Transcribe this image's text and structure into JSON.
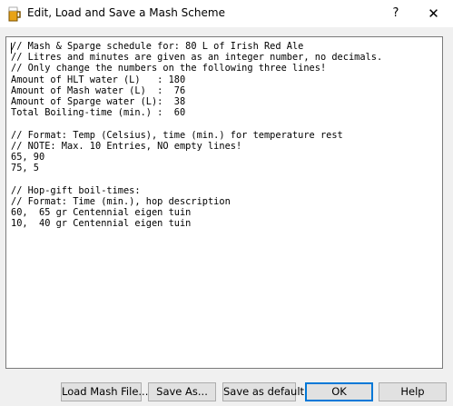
{
  "window": {
    "title": "Edit, Load and Save a Mash Scheme",
    "help_glyph": "?",
    "close_glyph": "✕",
    "icon": "beer-mug-icon"
  },
  "editor": {
    "lines": [
      "// Mash & Sparge schedule for: 80 L of Irish Red Ale",
      "// Litres and minutes are given as an integer number, no decimals.",
      "// Only change the numbers on the following three lines!",
      "Amount of HLT water (L)   : 180",
      "Amount of Mash water (L)  :  76",
      "Amount of Sparge water (L):  38",
      "Total Boiling-time (min.) :  60",
      "",
      "// Format: Temp (Celsius), time (min.) for temperature rest",
      "// NOTE: Max. 10 Entries, NO empty lines!",
      "65, 90",
      "75, 5",
      "",
      "// Hop-gift boil-times:",
      "// Format: Time (min.), hop description",
      "60,  65 gr Centennial eigen tuin",
      "10,  40 gr Centennial eigen tuin"
    ]
  },
  "buttons": {
    "load": "Load Mash File...",
    "save_as": "Save As...",
    "save_default": "Save as default",
    "ok": "OK",
    "help": "Help"
  }
}
